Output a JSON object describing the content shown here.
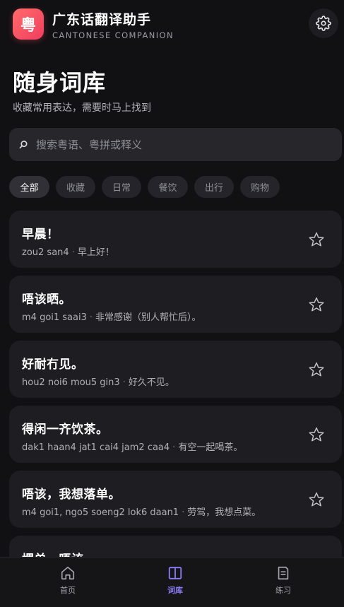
{
  "header": {
    "app_icon_char": "粤",
    "title": "广东话翻译助手",
    "subtitle": "CANTONESE COMPANION",
    "settings_icon": "gear-icon"
  },
  "page": {
    "title": "随身词库",
    "subtitle": "收藏常用表达，需要时马上找到"
  },
  "search": {
    "placeholder": "搜索粤语、粤拼或释义",
    "value": ""
  },
  "filters": [
    {
      "label": "全部",
      "active": true
    },
    {
      "label": "收藏",
      "active": false
    },
    {
      "label": "日常",
      "active": false
    },
    {
      "label": "餐饮",
      "active": false
    },
    {
      "label": "出行",
      "active": false
    },
    {
      "label": "购物",
      "active": false
    }
  ],
  "phrases": [
    {
      "title": "早晨！",
      "jyutping": "zou2 san4",
      "meaning": "早上好！"
    },
    {
      "title": "唔该晒。",
      "jyutping": "m4 goi1 saai3",
      "meaning": "非常感谢（别人帮忙后）。"
    },
    {
      "title": "好耐冇见。",
      "jyutping": "hou2 noi6 mou5 gin3",
      "meaning": "好久不见。"
    },
    {
      "title": "得闲一齐饮茶。",
      "jyutping": "dak1 haan4 jat1 cai4 jam2 caa4",
      "meaning": "有空一起喝茶。"
    },
    {
      "title": "唔该，我想落单。",
      "jyutping": "m4 goi1, ngo5 soeng2 lok6 daan1",
      "meaning": "劳驾，我想点菜。"
    },
    {
      "title": "埋单，唔该。",
      "jyutping": "",
      "meaning": ""
    }
  ],
  "separator": "·",
  "nav": [
    {
      "label": "首页",
      "icon": "home-icon",
      "active": false
    },
    {
      "label": "词库",
      "icon": "book-icon",
      "active": true
    },
    {
      "label": "练习",
      "icon": "practice-icon",
      "active": false
    }
  ],
  "colors": {
    "accent": "#8b7cf6",
    "brand": "#f03e5e",
    "background": "#111113",
    "card": "#1e1e22"
  }
}
